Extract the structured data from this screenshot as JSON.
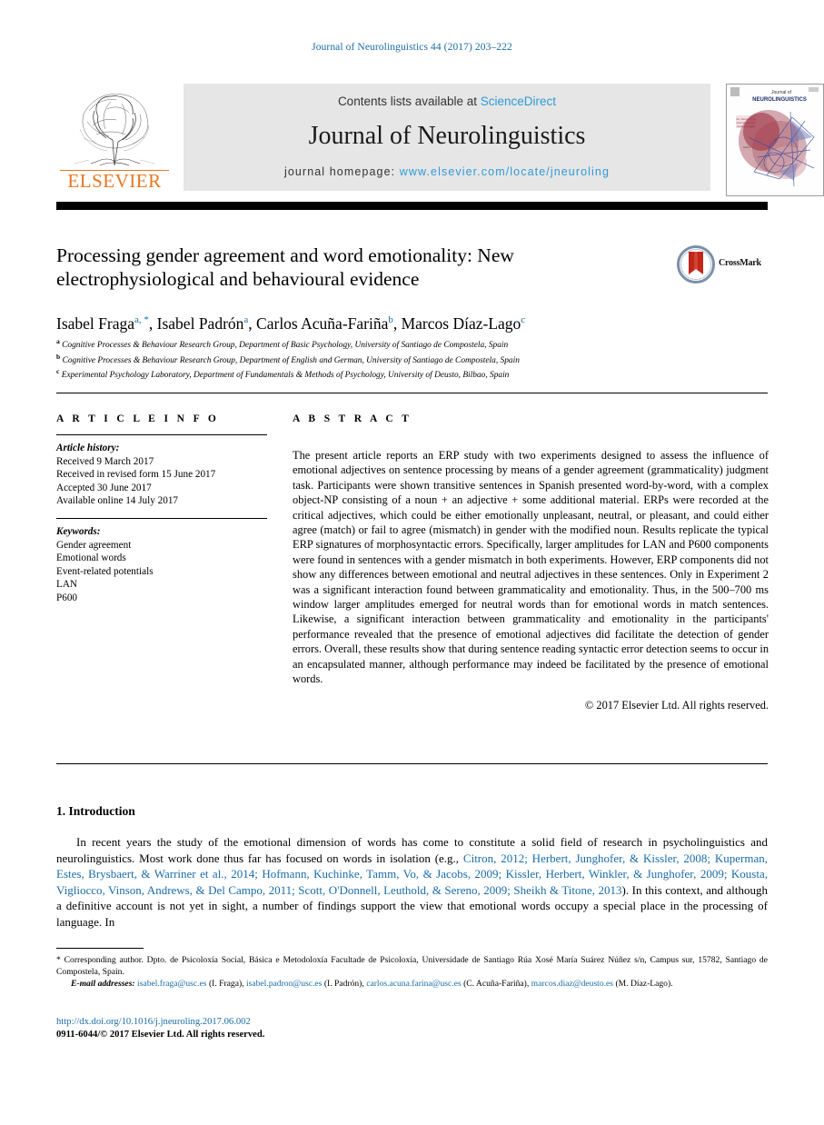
{
  "running_head": "Journal of Neurolinguistics 44 (2017) 203–222",
  "masthead": {
    "publisher": "ELSEVIER",
    "contents_prefix": "Contents lists available at ",
    "contents_link": "ScienceDirect",
    "journal_title": "Journal of Neurolinguistics",
    "homepage_prefix": "journal homepage: ",
    "homepage_link": "www.elsevier.com/locate/jneuroling",
    "cover_title_line1": "Journal of",
    "cover_title_line2": "NEUROLINGUISTICS"
  },
  "article": {
    "title": "Processing gender agreement and word emotionality: New electrophysiological and behavioural evidence",
    "crossmark_label": "CrossMark",
    "authors": [
      {
        "name": "Isabel Fraga",
        "marks": "a, *"
      },
      {
        "name": "Isabel Padrón",
        "marks": "a"
      },
      {
        "name": "Carlos Acuña-Fariña",
        "marks": "b"
      },
      {
        "name": "Marcos Díaz-Lago",
        "marks": "c"
      }
    ],
    "affiliations": [
      {
        "mark": "a",
        "text": "Cognitive Processes & Behaviour Research Group, Department of Basic Psychology, University of Santiago de Compostela, Spain"
      },
      {
        "mark": "b",
        "text": "Cognitive Processes & Behaviour Research Group, Department of English and German, University of Santiago de Compostela, Spain"
      },
      {
        "mark": "c",
        "text": "Experimental Psychology Laboratory, Department of Fundamentals & Methods of Psychology, University of Deusto, Bilbao, Spain"
      }
    ]
  },
  "article_info": {
    "heading": "A R T I C L E   I N F O",
    "history_label": "Article history:",
    "history": [
      "Received 9 March 2017",
      "Received in revised form 15 June 2017",
      "Accepted 30 June 2017",
      "Available online 14 July 2017"
    ],
    "keywords_label": "Keywords:",
    "keywords": [
      "Gender agreement",
      "Emotional words",
      "Event-related potentials",
      "LAN",
      "P600"
    ]
  },
  "abstract": {
    "heading": "A B S T R A C T",
    "text": "The present article reports an ERP study with two experiments designed to assess the influence of emotional adjectives on sentence processing by means of a gender agreement (grammaticality) judgment task. Participants were shown transitive sentences in Spanish presented word-by-word, with a complex object-NP consisting of a noun + an adjective + some additional material. ERPs were recorded at the critical adjectives, which could be either emotionally unpleasant, neutral, or pleasant, and could either agree (match) or fail to agree (mismatch) in gender with the modified noun. Results replicate the typical ERP signatures of morphosyntactic errors. Specifically, larger amplitudes for LAN and P600 components were found in sentences with a gender mismatch in both experiments. However, ERP components did not show any differences between emotional and neutral adjectives in these sentences. Only in Experiment 2 was a significant interaction found between grammaticality and emotionality. Thus, in the 500–700 ms window larger amplitudes emerged for neutral words than for emotional words in match sentences. Likewise, a significant interaction between grammaticality and emotionality in the participants' performance revealed that the presence of emotional adjectives did facilitate the detection of gender errors. Overall, these results show that during sentence reading syntactic error detection seems to occur in an encapsulated manner, although performance may indeed be facilitated by the presence of emotional words.",
    "copyright": "© 2017 Elsevier Ltd. All rights reserved."
  },
  "introduction": {
    "heading": "1. Introduction",
    "part1": "In recent years the study of the emotional dimension of words has come to constitute a solid field of research in psycholinguistics and neurolinguistics. Most work done thus far has focused on words in isolation (e.g., ",
    "citations": "Citron, 2012; Herbert, Junghofer, & Kissler, 2008; Kuperman, Estes, Brysbaert, & Warriner et al., 2014; Hofmann, Kuchinke, Tamm, Vo, & Jacobs, 2009; Kissler, Herbert, Winkler, & Junghofer, 2009; Kousta, Vigliocco, Vinson, Andrews, & Del Campo, 2011; Scott, O'Donnell, Leuthold, & Sereno, 2009; Sheikh & Titone, 2013",
    "part2": "). In this context, and although a definitive account is not yet in sight, a number of findings support the view that emotional words occupy a special place in the processing of language. In"
  },
  "footnotes": {
    "corresponding": "* Corresponding author. Dpto. de Psicoloxía Social, Básica e Metodoloxía Facultade de Psicoloxía, Universidade de Santiago Rúa Xosé María Suárez Núñez s/n, Campus sur, 15782, Santiago de Compostela, Spain.",
    "email_label": "E-mail addresses:",
    "emails": [
      {
        "address": "isabel.fraga@usc.es",
        "person": "(I. Fraga),"
      },
      {
        "address": "isabel.padron@usc.es",
        "person": "(I. Padrón),"
      },
      {
        "address": "carlos.acuna.farina@usc.es",
        "person": "(C. Acuña-Fariña),"
      },
      {
        "address": "marcos.diaz@deusto.es",
        "person": "(M. Díaz-Lago)."
      }
    ]
  },
  "footer": {
    "doi": "http://dx.doi.org/10.1016/j.jneuroling.2017.06.002",
    "issn": "0911-6044/© 2017 Elsevier Ltd. All rights reserved."
  }
}
